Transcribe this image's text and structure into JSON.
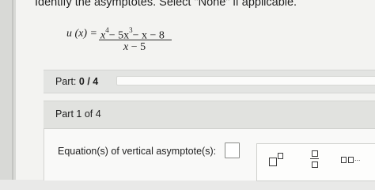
{
  "question": {
    "prompt": "Identify the asymptotes. Select \"None\" if applicable.",
    "function": {
      "lhs": "u (x) =",
      "numerator": {
        "x_var": "x",
        "exp1": "4",
        "term2": "− 5x",
        "exp2": "3",
        "term3": "− x − 8"
      },
      "denominator": {
        "var": "x",
        "rest": "− 5"
      }
    }
  },
  "progress": {
    "label": "Part:",
    "value": "0 / 4",
    "completed": 0,
    "total": 4
  },
  "part": {
    "title": "Part 1 of 4",
    "equation_label": "Equation(s) of vertical asymptote(s):"
  },
  "toolbar": {
    "tools": [
      {
        "icon": "exponent-icon"
      },
      {
        "icon": "fraction-icon"
      },
      {
        "icon": "list-icon",
        "text": "..."
      }
    ]
  }
}
